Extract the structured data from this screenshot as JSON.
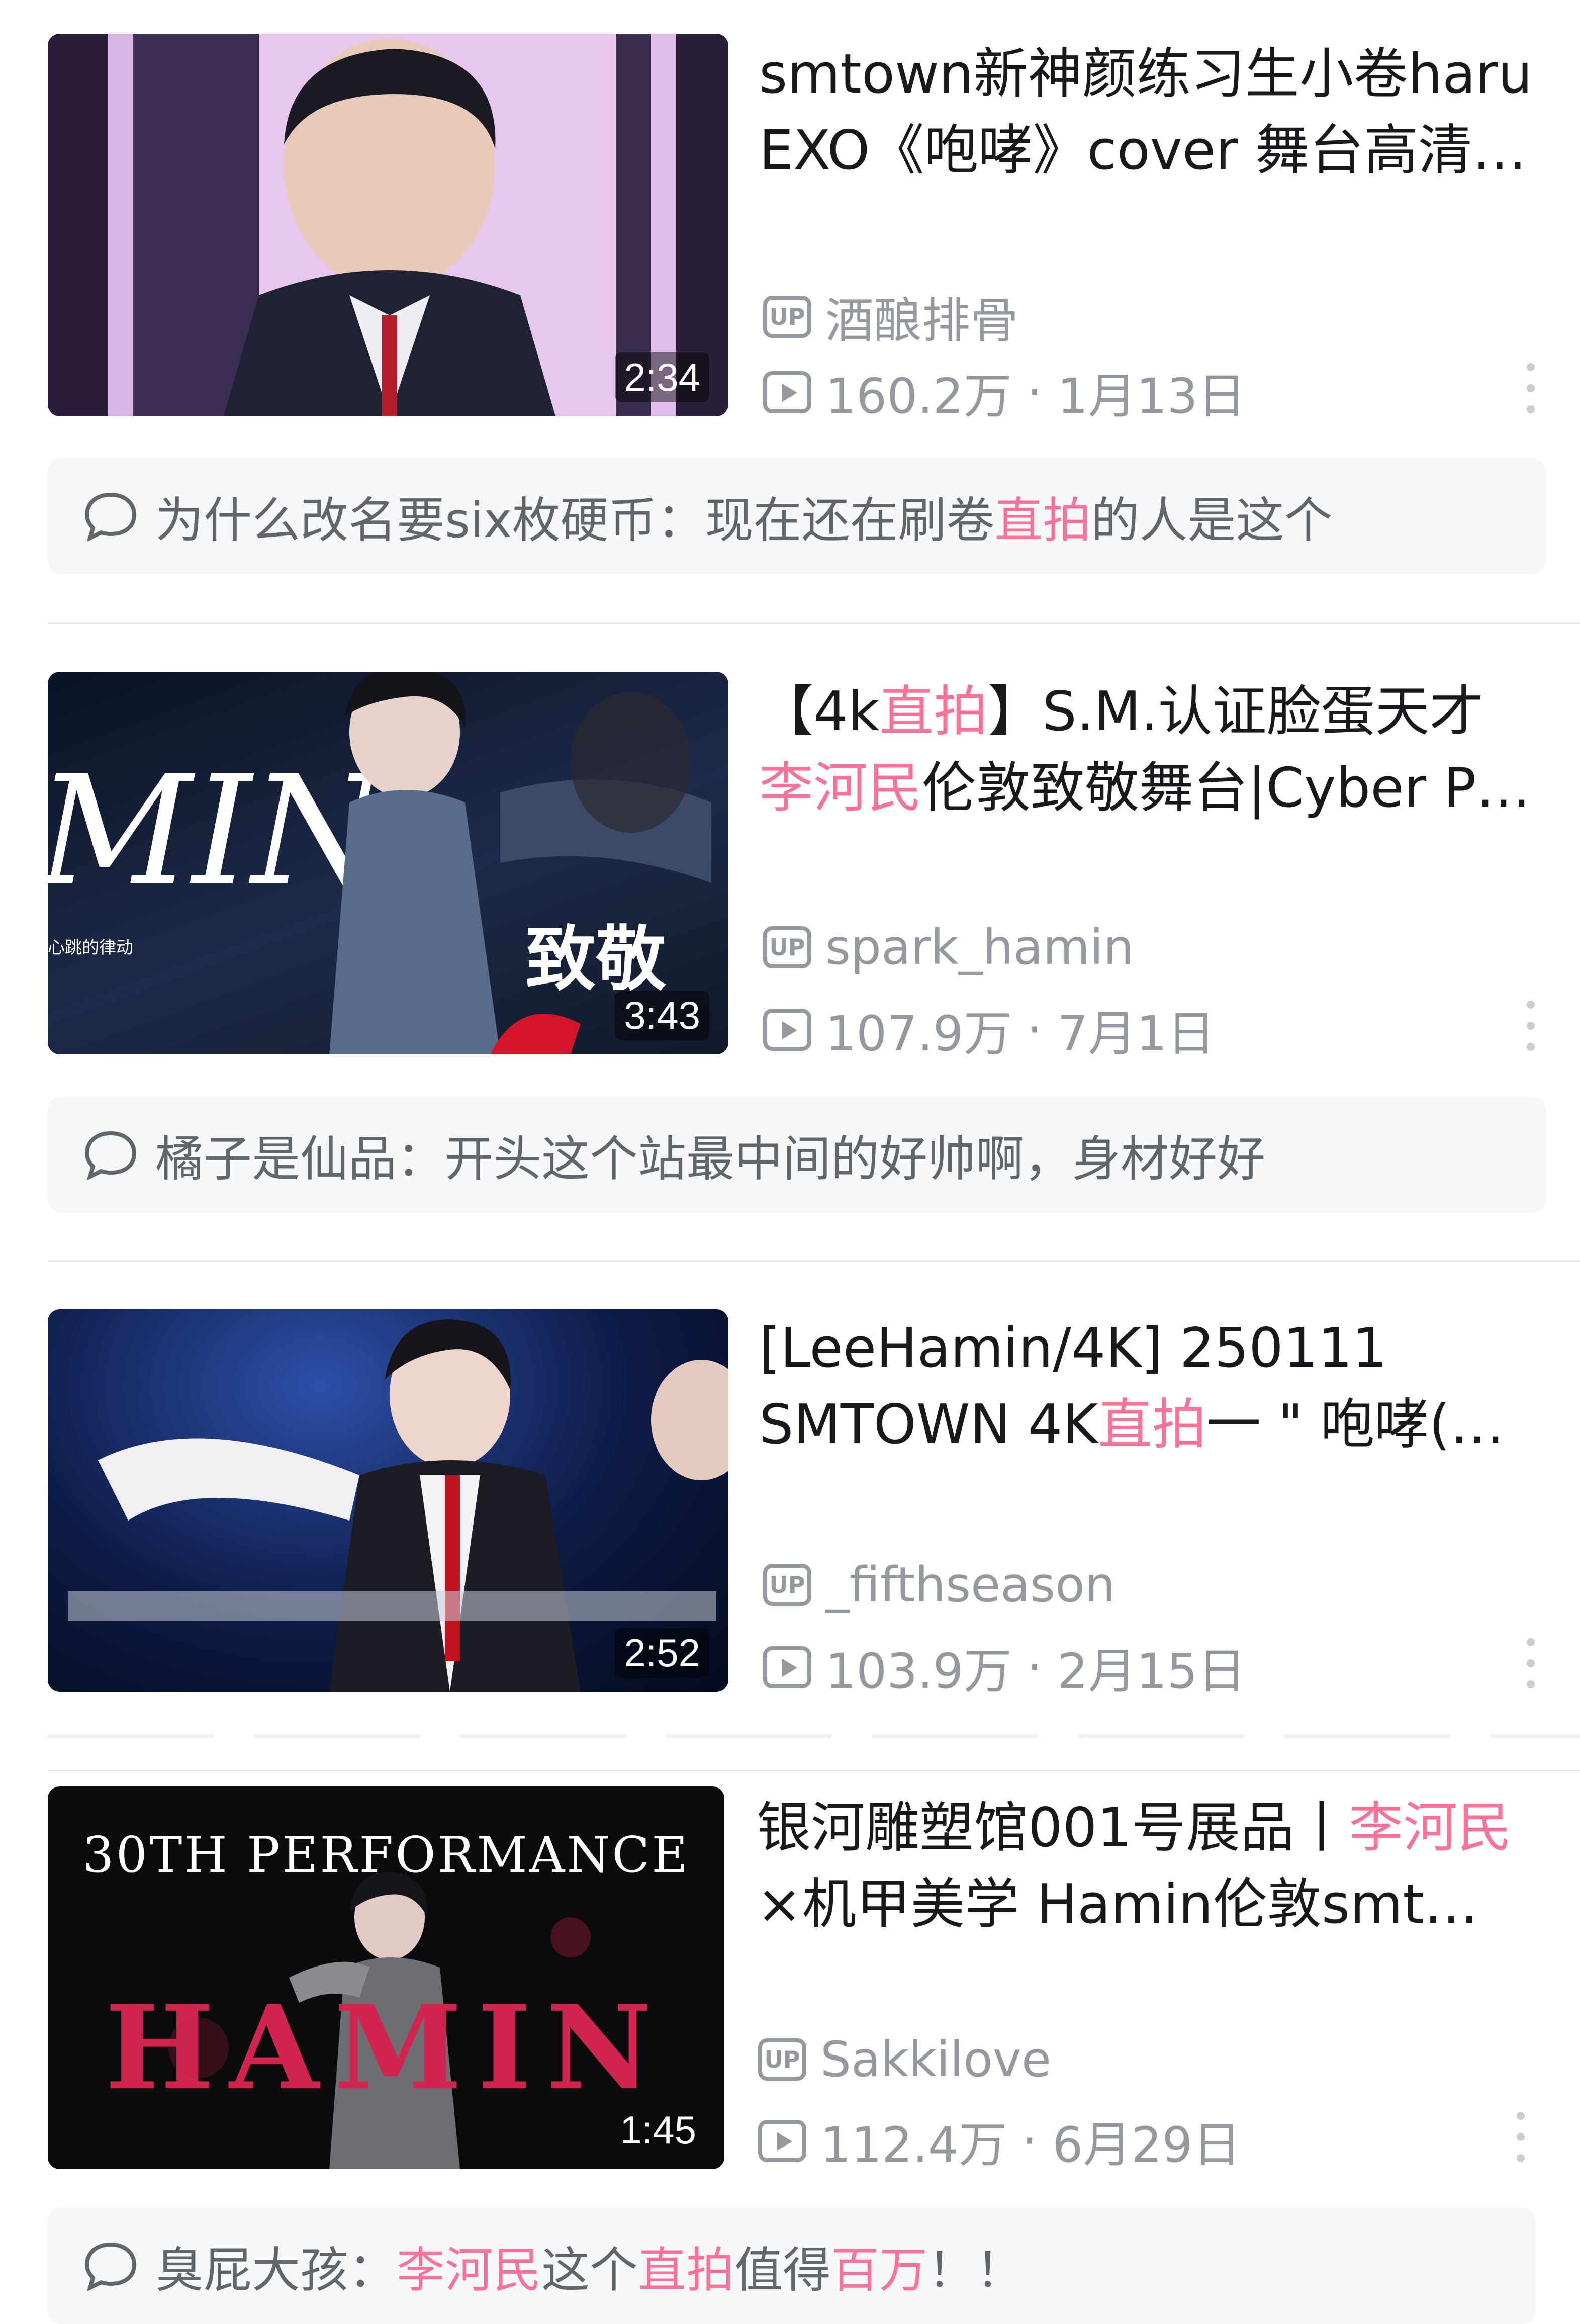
{
  "videos": [
    {
      "title_line1": "smtown新神颜练习生小卷haru",
      "title_line2": "EXO《咆哮》cover 舞台高清…",
      "duration": "2:34",
      "uploader": "酒酿排骨",
      "views": "160.2万",
      "date": "1月13日",
      "comment": {
        "user": "为什么改名要six枚硬币：",
        "text_pre": "现在还在刷卷",
        "hl": "直拍",
        "text_post": "的人是这个"
      }
    },
    {
      "title_line1_pre": "【4k",
      "title_line1_hl": "直拍",
      "title_line1_post": "】S.M.认证脸蛋天才",
      "title_line2_hl": "李河民",
      "title_line2_post": "伦敦致敬舞台|Cyber P…",
      "duration": "3:43",
      "uploader": "spark_hamin",
      "views": "107.9万",
      "date": "7月1日",
      "thumb_text_big": "MIN",
      "thumb_text_cn": "致敬",
      "thumb_text_small": "心跳的律动",
      "comment": {
        "user": "橘子是仙品：",
        "text": "开头这个站最中间的好帅啊，身材好好"
      }
    },
    {
      "title_line1": "[LeeHamin/4K] 250111",
      "title_line2_pre": "SMTOWN 4K",
      "title_line2_hl": "直拍",
      "title_line2_post": "一 \" 咆哮(…",
      "duration": "2:52",
      "uploader": "_fifthseason",
      "views": "103.9万",
      "date": "2月15日"
    },
    {
      "title_line1_pre": "银河雕塑馆001号展品丨",
      "title_line1_hl": "李河民",
      "title_line2": "×机甲美学 Hamin伦敦smt致…",
      "duration": "1:45",
      "uploader": "Sakkilove",
      "views": "112.4万",
      "date": "6月29日",
      "thumb_text_top": "30TH PERFORMANCE",
      "thumb_text_name": "HAMIN",
      "comment": {
        "user": "臭屁大孩：",
        "hl1": "李河民",
        "mid": "这个",
        "hl2": "直拍",
        "mid2": "值得",
        "hl3": "百万",
        "end": "！！"
      }
    }
  ],
  "colors": {
    "accent": "#fb7299",
    "meta": "#9499a0",
    "comment_bg": "#f6f7f8"
  },
  "icons": {
    "up": "up-badge-icon",
    "play": "play-count-icon",
    "more": "more-vertical-icon",
    "comment": "comment-bubble-icon"
  }
}
